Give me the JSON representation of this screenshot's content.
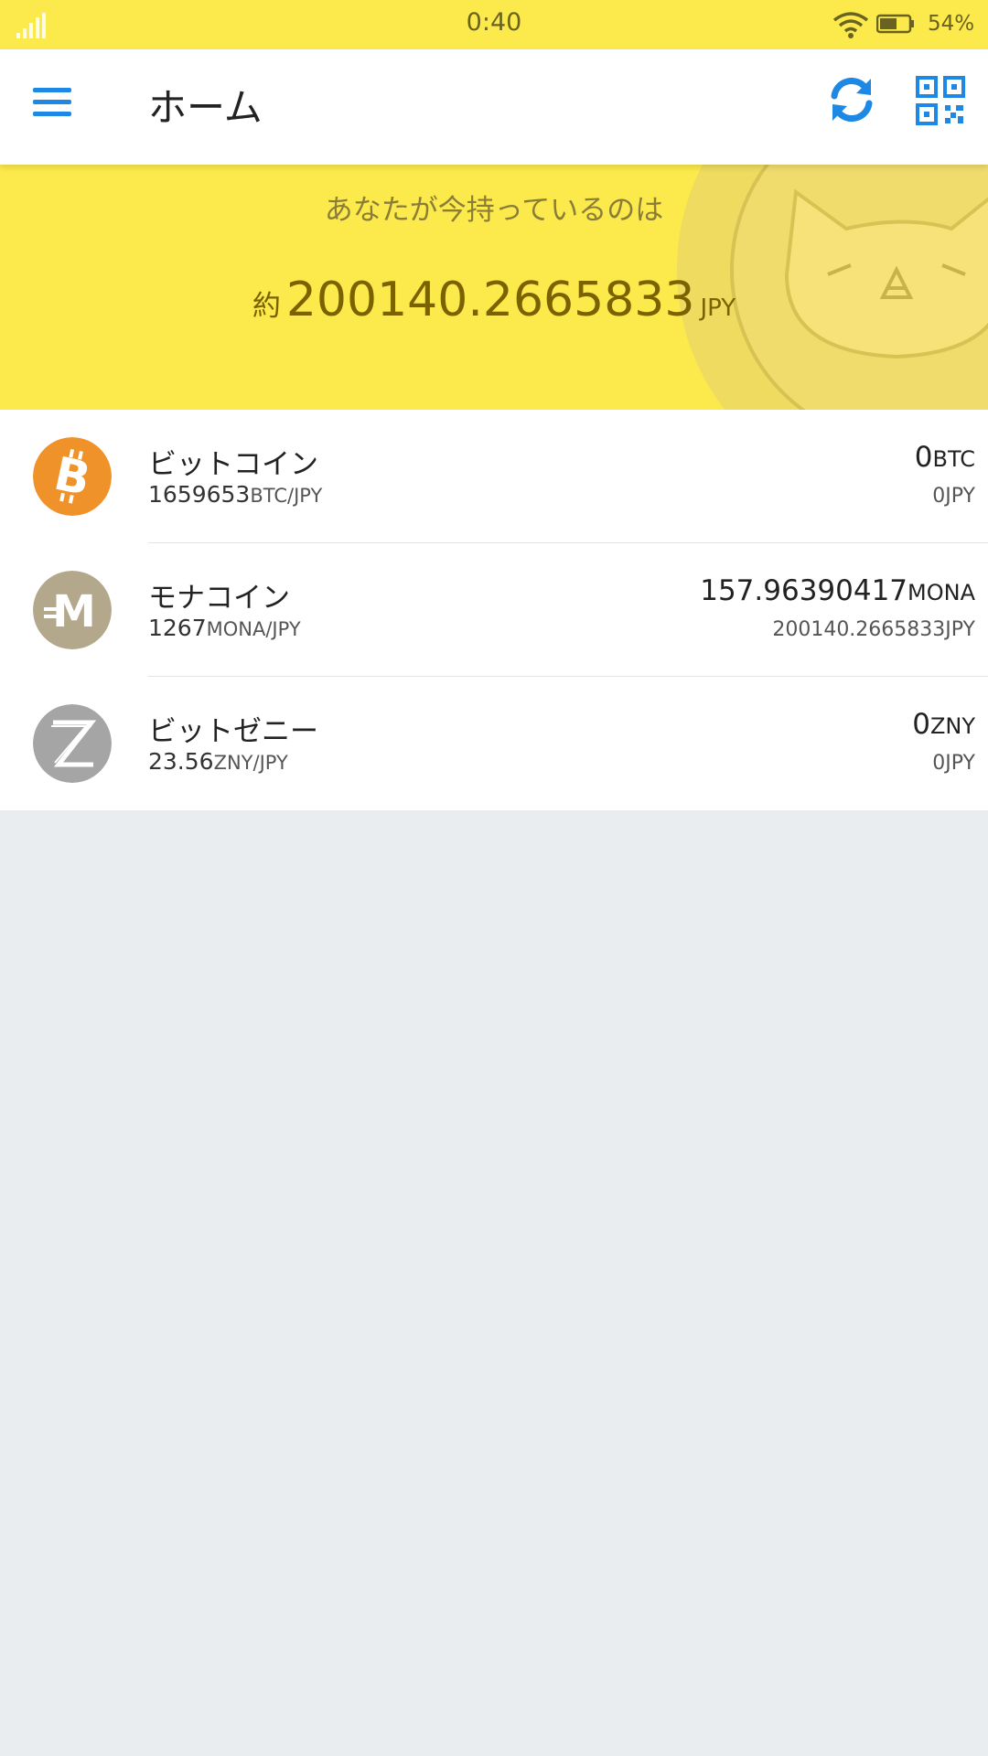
{
  "status_bar": {
    "time": "0:40",
    "battery_percent": "54%"
  },
  "toolbar": {
    "title": "ホーム"
  },
  "banner": {
    "caption": "あなたが今持っているのは",
    "approx_label": "約",
    "total_amount": "200140.2665833",
    "total_unit": "JPY"
  },
  "coins": [
    {
      "name": "ビットコイン",
      "rate_value": "1659653",
      "rate_pair": "BTC/JPY",
      "balance": "0",
      "symbol": "BTC",
      "jpy_value": "0JPY",
      "icon": "bitcoin-icon",
      "color": "#f0922a"
    },
    {
      "name": "モナコイン",
      "rate_value": "1267",
      "rate_pair": "MONA/JPY",
      "balance": "157.96390417",
      "symbol": "MONA",
      "jpy_value": "200140.2665833JPY",
      "icon": "monacoin-icon",
      "color": "#b3a88c"
    },
    {
      "name": "ビットゼニー",
      "rate_value": "23.56",
      "rate_pair": "ZNY/JPY",
      "balance": "0",
      "symbol": "ZNY",
      "jpy_value": "0JPY",
      "icon": "bitzeny-icon",
      "color": "#a5a5a5"
    }
  ],
  "theme": {
    "accent": "#1e88e5",
    "banner": "#fce94b",
    "background": "#e9edf0"
  }
}
